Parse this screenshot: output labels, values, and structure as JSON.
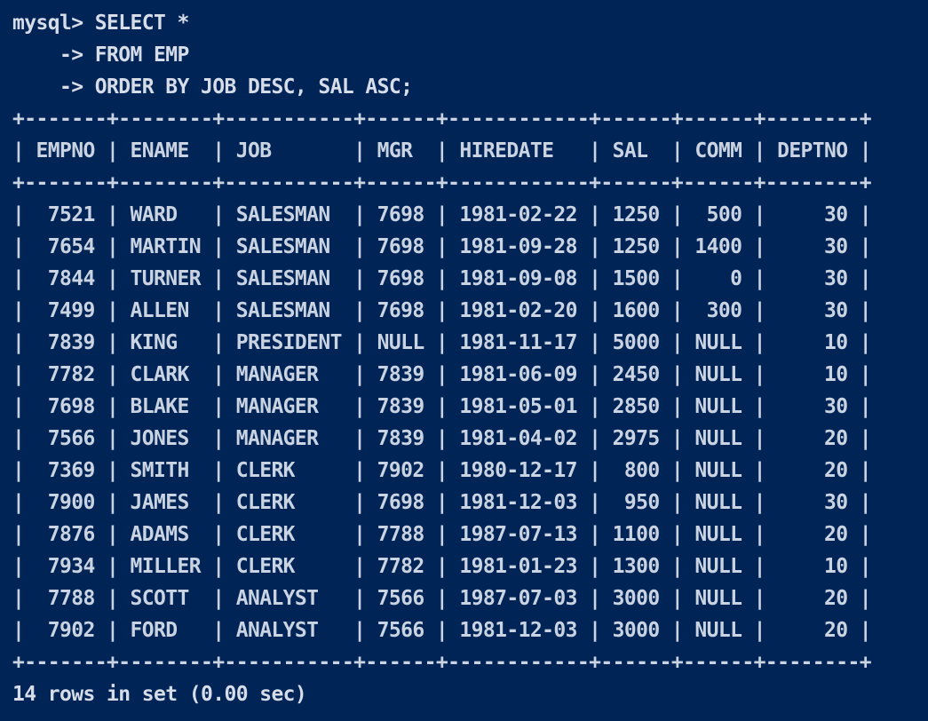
{
  "session": {
    "prompt": "mysql>",
    "continuation_prompt": "->",
    "query_lines": [
      "SELECT *",
      "FROM EMP",
      "ORDER BY JOB DESC, SAL ASC;"
    ]
  },
  "result": {
    "columns": [
      "EMPNO",
      "ENAME",
      "JOB",
      "MGR",
      "HIREDATE",
      "SAL",
      "COMM",
      "DEPTNO"
    ],
    "rows": [
      [
        "7521",
        "WARD",
        "SALESMAN",
        "7698",
        "1981-02-22",
        "1250",
        "500",
        "30"
      ],
      [
        "7654",
        "MARTIN",
        "SALESMAN",
        "7698",
        "1981-09-28",
        "1250",
        "1400",
        "30"
      ],
      [
        "7844",
        "TURNER",
        "SALESMAN",
        "7698",
        "1981-09-08",
        "1500",
        "0",
        "30"
      ],
      [
        "7499",
        "ALLEN",
        "SALESMAN",
        "7698",
        "1981-02-20",
        "1600",
        "300",
        "30"
      ],
      [
        "7839",
        "KING",
        "PRESIDENT",
        "NULL",
        "1981-11-17",
        "5000",
        "NULL",
        "10"
      ],
      [
        "7782",
        "CLARK",
        "MANAGER",
        "7839",
        "1981-06-09",
        "2450",
        "NULL",
        "10"
      ],
      [
        "7698",
        "BLAKE",
        "MANAGER",
        "7839",
        "1981-05-01",
        "2850",
        "NULL",
        "30"
      ],
      [
        "7566",
        "JONES",
        "MANAGER",
        "7839",
        "1981-04-02",
        "2975",
        "NULL",
        "20"
      ],
      [
        "7369",
        "SMITH",
        "CLERK",
        "7902",
        "1980-12-17",
        "800",
        "NULL",
        "20"
      ],
      [
        "7900",
        "JAMES",
        "CLERK",
        "7698",
        "1981-12-03",
        "950",
        "NULL",
        "30"
      ],
      [
        "7876",
        "ADAMS",
        "CLERK",
        "7788",
        "1987-07-13",
        "1100",
        "NULL",
        "20"
      ],
      [
        "7934",
        "MILLER",
        "CLERK",
        "7782",
        "1981-01-23",
        "1300",
        "NULL",
        "10"
      ],
      [
        "7788",
        "SCOTT",
        "ANALYST",
        "7566",
        "1987-07-03",
        "3000",
        "NULL",
        "20"
      ],
      [
        "7902",
        "FORD",
        "ANALYST",
        "7566",
        "1981-12-03",
        "3000",
        "NULL",
        "20"
      ]
    ],
    "status": "14 rows in set (0.00 sec)"
  },
  "colors": {
    "background": "#012456",
    "foreground": "#cdd6e4"
  }
}
